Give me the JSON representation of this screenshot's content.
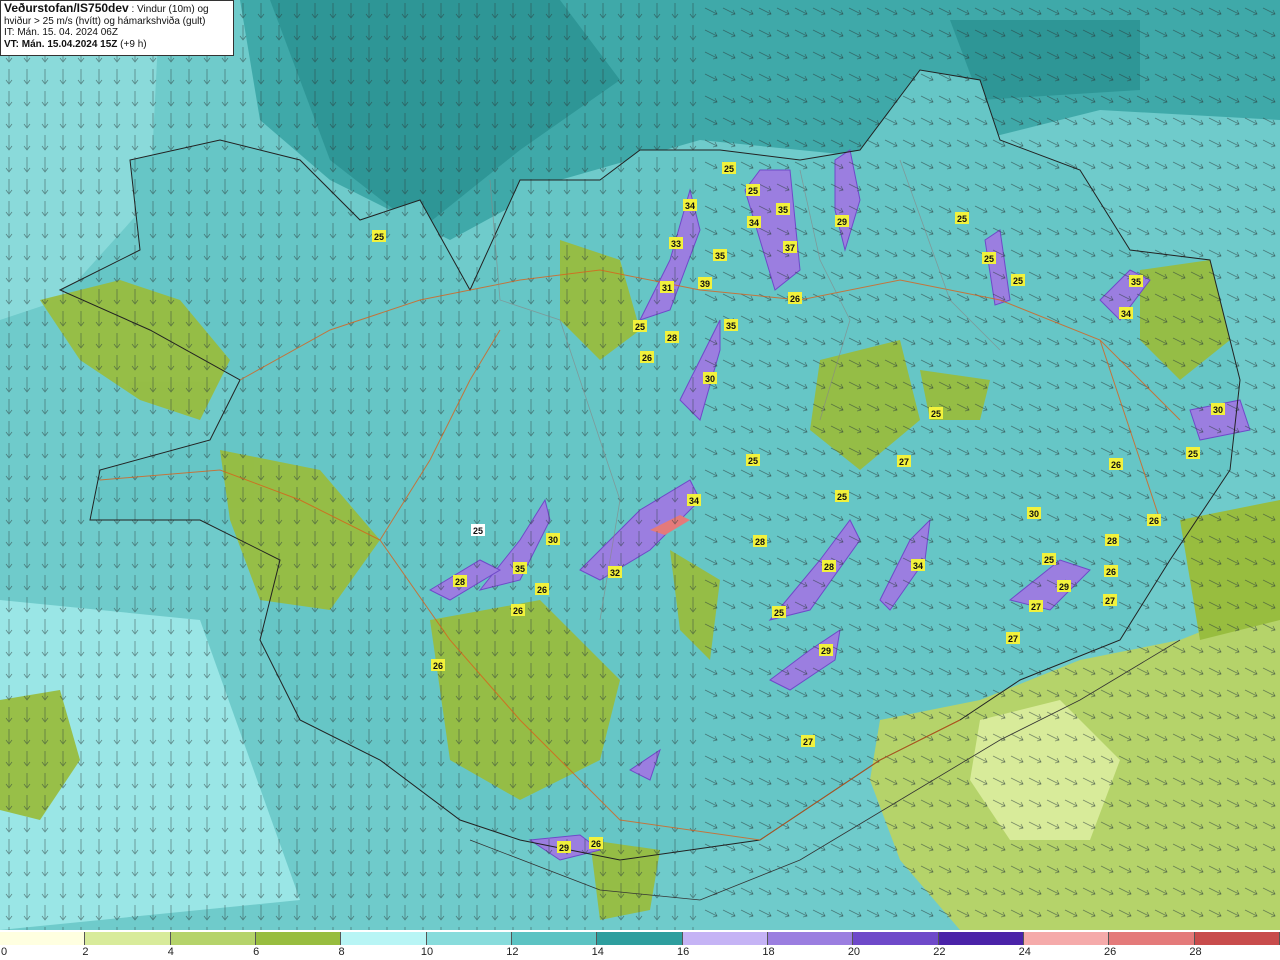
{
  "header": {
    "source": "Veðurstofan/IS750dev",
    "description_line1": " : Vindur (10m) og",
    "description_line2": "hviður > 25 m/s (hvítt) og hámarkshviða (gult)",
    "issue_time": "IT: Mán. 15. 04. 2024 06Z",
    "valid_time_label": "VT: Mán. 15.04.2024 15Z",
    "valid_time_offset": " (+9 h)"
  },
  "legend": {
    "colors": [
      "#ffffe0",
      "#d8eb9a",
      "#b5d36a",
      "#98bd3f",
      "#b8f5f5",
      "#88dcdc",
      "#5cc3c3",
      "#2e9e9e",
      "#c5b3f5",
      "#9b7ee0",
      "#6f49c9",
      "#4a22a8",
      "#f5aaaa",
      "#e47a7a",
      "#c84c4c"
    ],
    "ticks": [
      "0",
      "2",
      "4",
      "6",
      "8",
      "10",
      "12",
      "14",
      "16",
      "18",
      "20",
      "22",
      "24",
      "26",
      "28"
    ]
  },
  "gust_markers": [
    {
      "label": "25"
    },
    {
      "label": "34"
    },
    {
      "label": "33"
    },
    {
      "label": "31"
    },
    {
      "label": "25"
    },
    {
      "label": "26"
    },
    {
      "label": "28"
    },
    {
      "label": "35"
    },
    {
      "label": "39"
    },
    {
      "label": "35"
    },
    {
      "label": "30"
    },
    {
      "label": "25"
    },
    {
      "label": "34"
    },
    {
      "label": "25"
    },
    {
      "label": "35"
    },
    {
      "label": "37"
    },
    {
      "label": "26"
    },
    {
      "label": "29"
    },
    {
      "label": "25"
    },
    {
      "label": "25"
    },
    {
      "label": "25"
    },
    {
      "label": "35"
    },
    {
      "label": "34"
    },
    {
      "label": "25"
    },
    {
      "label": "27"
    },
    {
      "label": "30"
    },
    {
      "label": "25"
    },
    {
      "label": "26"
    },
    {
      "label": "25"
    },
    {
      "label": "30"
    },
    {
      "label": "28"
    },
    {
      "label": "35"
    },
    {
      "label": "26"
    },
    {
      "label": "26"
    },
    {
      "label": "26"
    },
    {
      "label": "34"
    },
    {
      "label": "32"
    },
    {
      "label": "25"
    },
    {
      "label": "28"
    },
    {
      "label": "25"
    },
    {
      "label": "28"
    },
    {
      "label": "25"
    },
    {
      "label": "29"
    },
    {
      "label": "34"
    },
    {
      "label": "30"
    },
    {
      "label": "25"
    },
    {
      "label": "28"
    },
    {
      "label": "29"
    },
    {
      "label": "26"
    },
    {
      "label": "27"
    },
    {
      "label": "27"
    },
    {
      "label": "27"
    },
    {
      "label": "26"
    },
    {
      "label": "27"
    },
    {
      "label": "29"
    },
    {
      "label": "26"
    }
  ]
}
